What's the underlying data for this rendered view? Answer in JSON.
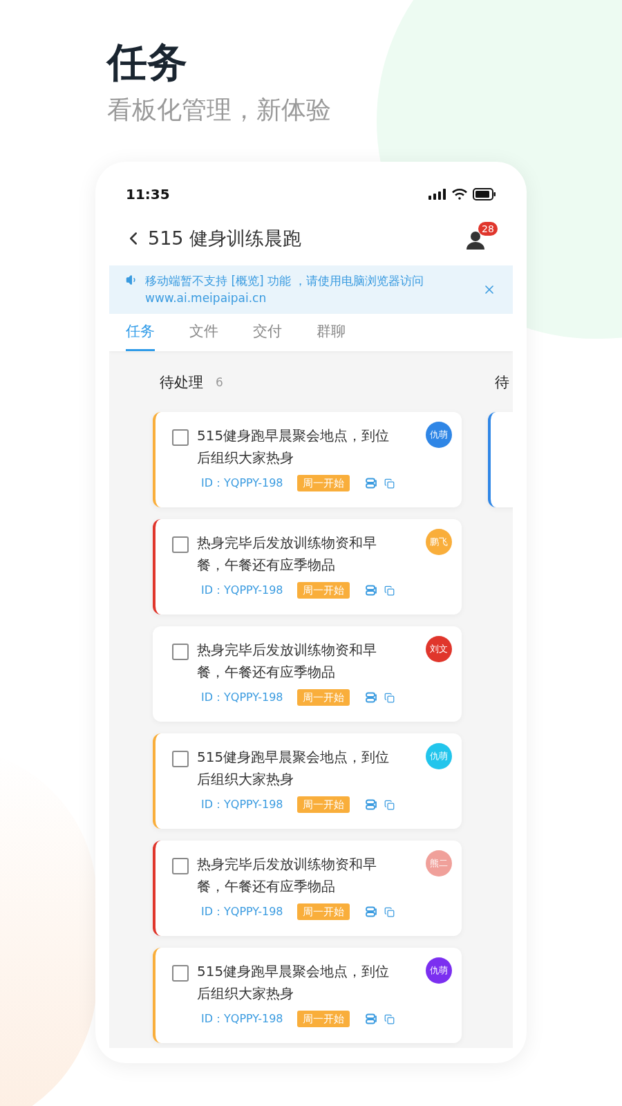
{
  "page": {
    "title": "任务",
    "subtitle": "看板化管理，新体验"
  },
  "status_bar": {
    "time": "11:35"
  },
  "header": {
    "title": "515 健身训练晨跑",
    "member_badge": "28"
  },
  "notice": {
    "text": "移动端暂不支持 [概览] 功能 ，请使用电脑浏览器访问",
    "url": "www.ai.meipaipai.cn"
  },
  "tabs": [
    {
      "label": "任务",
      "selected": true
    },
    {
      "label": "文件",
      "selected": false
    },
    {
      "label": "交付",
      "selected": false
    },
    {
      "label": "群聊",
      "selected": false
    }
  ],
  "board": {
    "columns": [
      {
        "title": "待处理",
        "count": "6",
        "cards": [
          {
            "title": "515健身跑早晨聚会地点，到位后组织大家热身",
            "checked": false,
            "color": "#f9ae3b",
            "id": "ID：YQPPY-198",
            "tag": "周一开始",
            "assignee": {
              "name": "仇萌",
              "color": "#2f86e6"
            }
          },
          {
            "title": "热身完毕后发放训练物资和早餐，午餐还有应季物品",
            "checked": false,
            "color": "#e0362c",
            "id": "ID：YQPPY-198",
            "tag": "周一开始",
            "assignee": {
              "name": "鹏飞",
              "color": "#f9ae3b"
            }
          },
          {
            "title": "热身完毕后发放训练物资和早餐，午餐还有应季物品",
            "checked": false,
            "id": "ID：YQPPY-198",
            "tag": "周一开始",
            "assignee": {
              "name": "刘文",
              "color": "#e0362c"
            }
          },
          {
            "title": "515健身跑早晨聚会地点，到位后组织大家热身",
            "checked": false,
            "color": "#f9ae3b",
            "id": "ID：YQPPY-198",
            "tag": "周一开始",
            "assignee": {
              "name": "仇萌",
              "color": "#22c5ec"
            }
          },
          {
            "title": "热身完毕后发放训练物资和早餐，午餐还有应季物品",
            "checked": false,
            "color": "#e0362c",
            "id": "ID：YQPPY-198",
            "tag": "周一开始",
            "assignee": {
              "name": "熊二",
              "color": "#f0a09a"
            }
          },
          {
            "title": "515健身跑早晨聚会地点，到位后组织大家热身",
            "checked": false,
            "color": "#f9ae3b",
            "id": "ID：YQPPY-198",
            "tag": "周一开始",
            "assignee": {
              "name": "仇萌",
              "color": "#7b2ff0"
            }
          }
        ]
      },
      {
        "title": "待",
        "cards": [
          {
            "color": "#2f86e6"
          }
        ]
      }
    ]
  }
}
